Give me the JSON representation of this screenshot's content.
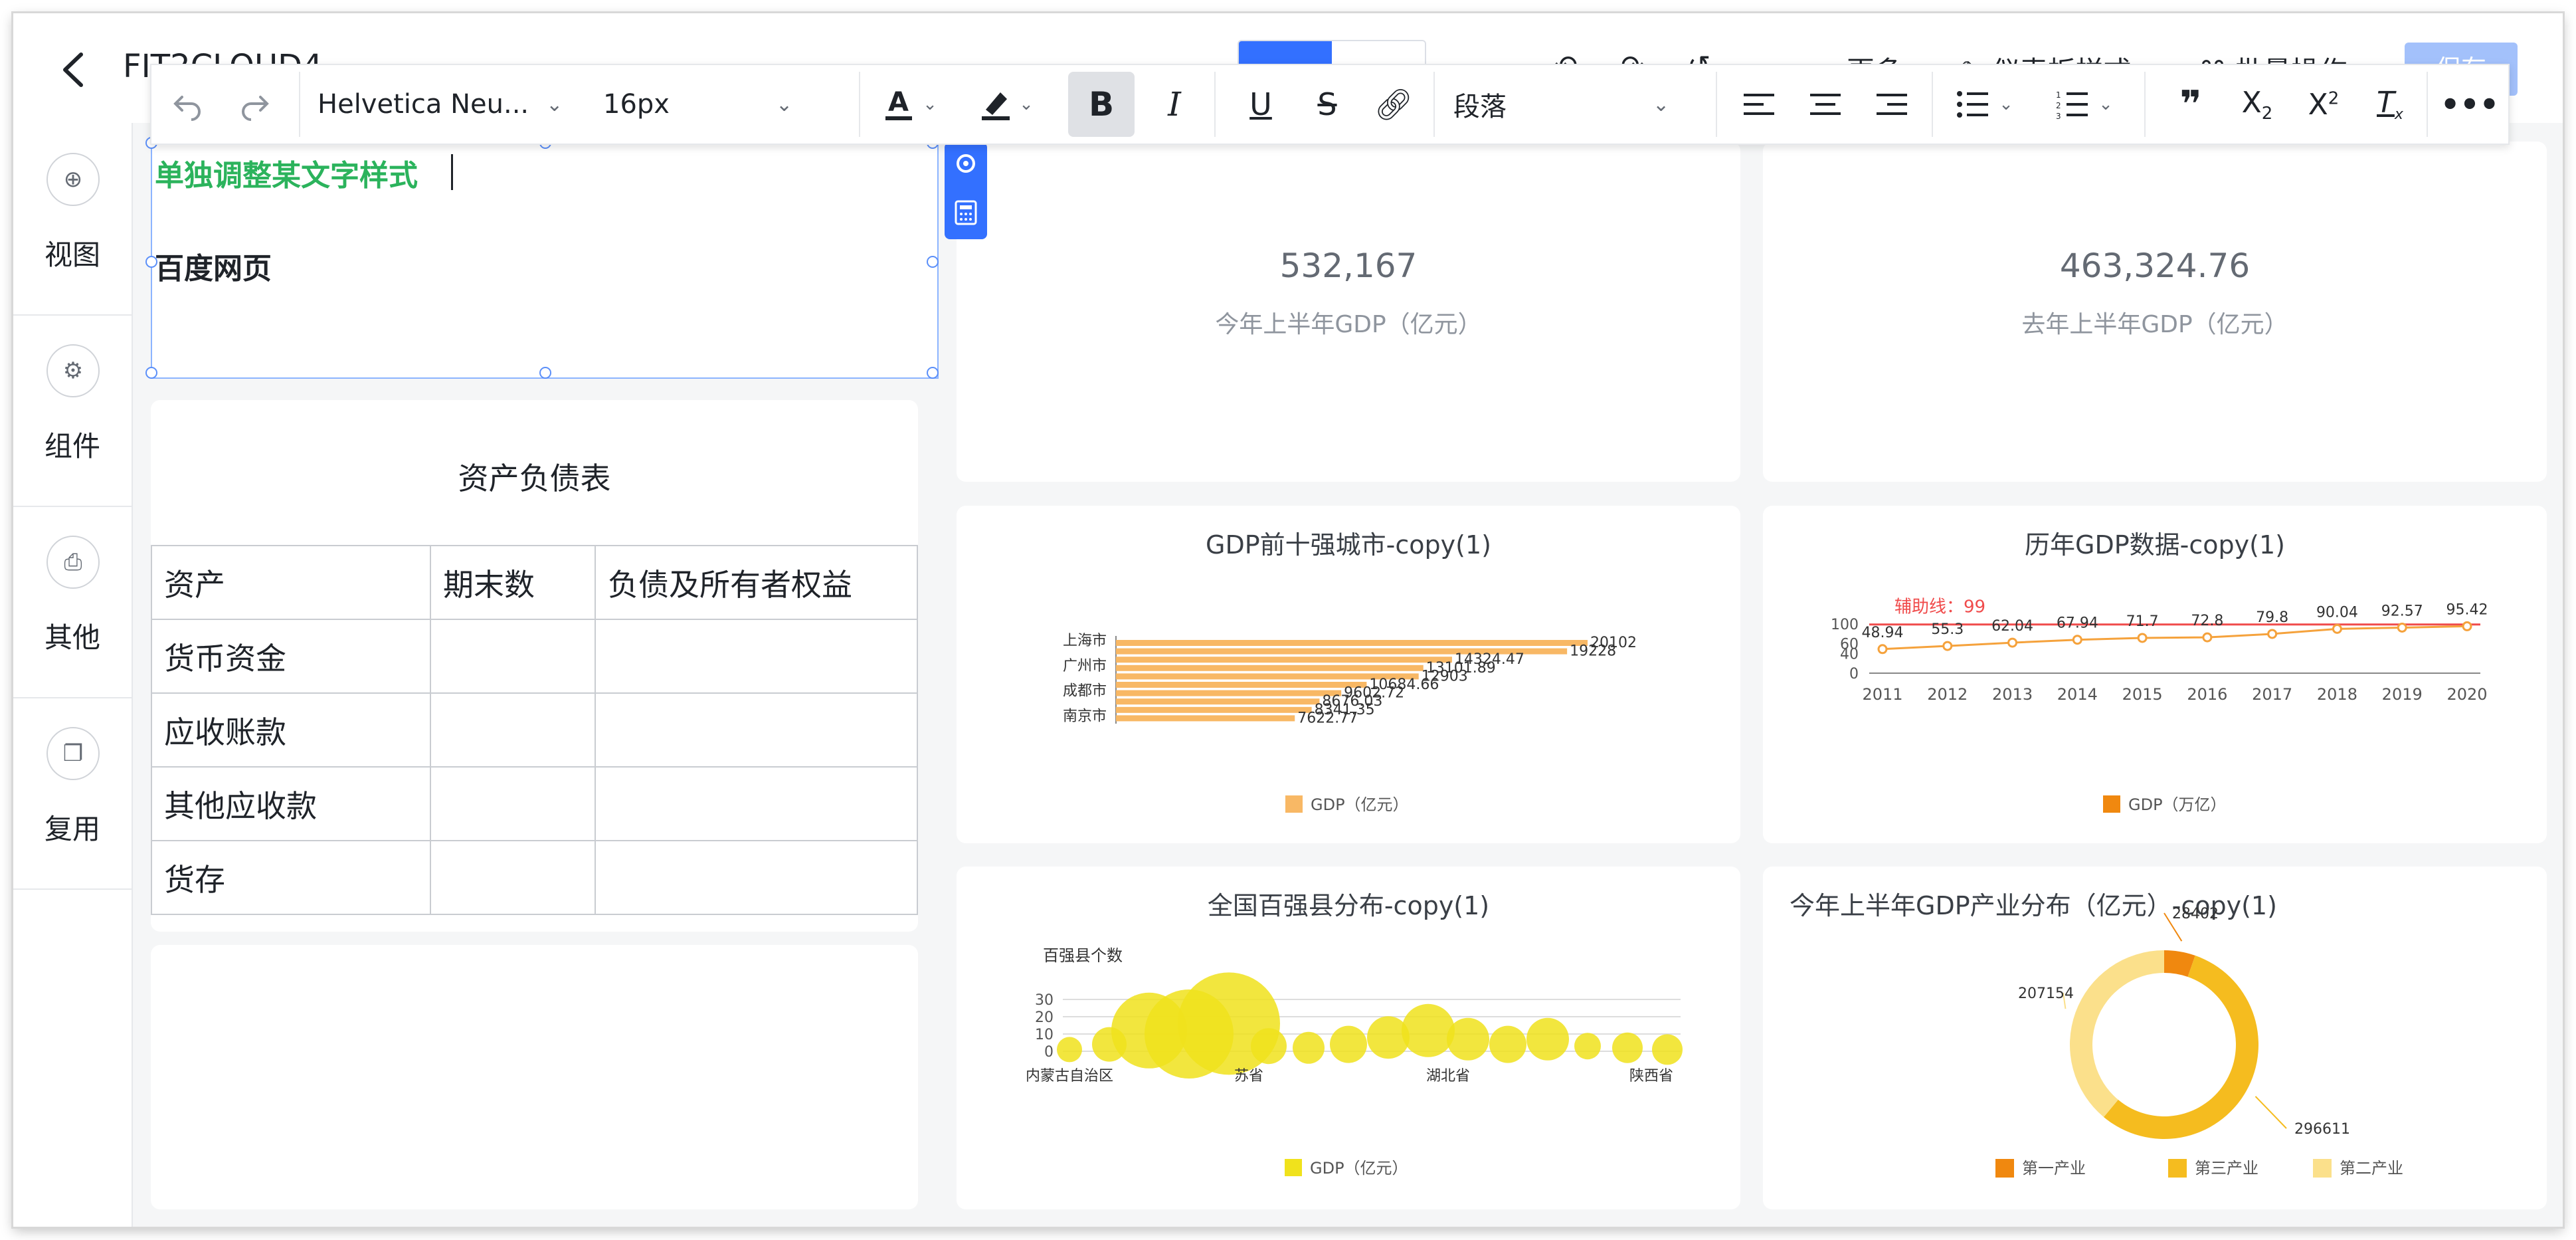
{
  "app": {
    "title": "FIT2CLOUD4"
  },
  "top_actions": {
    "more": "更多",
    "style": "仪表板样式",
    "batch": "批量操作",
    "save": "保存"
  },
  "sidebar": {
    "items": [
      {
        "label": "视图",
        "icon": "plus-circle-icon"
      },
      {
        "label": "组件",
        "icon": "gear-icon"
      },
      {
        "label": "其他",
        "icon": "printer-icon"
      },
      {
        "label": "复用",
        "icon": "copy-icon"
      }
    ]
  },
  "toolbar": {
    "font_family": "Helvetica Neu...",
    "font_size": "16px",
    "block_format": "段落"
  },
  "rich_text": {
    "line1": "单独调整某文字样式",
    "line2": "百度网页"
  },
  "balance_sheet": {
    "title": "资产负债表",
    "rows": [
      [
        "资产",
        "期末数",
        "负债及所有者权益"
      ],
      [
        "货币资金",
        "",
        ""
      ],
      [
        "应收账款",
        "",
        ""
      ],
      [
        "其他应收款",
        "",
        ""
      ],
      [
        "货存",
        "",
        ""
      ]
    ]
  },
  "kpis": [
    {
      "value": "532,167",
      "label": "今年上半年GDP（亿元）"
    },
    {
      "value": "463,324.76",
      "label": "去年上半年GDP（亿元）"
    }
  ],
  "colors": {
    "accent": "#3370ff",
    "bar": "#f8b865",
    "line": "#f5a23c",
    "aux_line": "#f04b4b",
    "bubble": "#f0e21c",
    "donut_primary": "#f0880f",
    "donut_tertiary": "#f5bc1f",
    "donut_secondary": "#fbe08b"
  },
  "chart_data": [
    {
      "type": "bar",
      "orientation": "horizontal",
      "title": "GDP前十强城市-copy(1)",
      "categories": [
        "上海市",
        "",
        "广州市",
        "",
        "成都市",
        "",
        "南京市"
      ],
      "values": [
        20102,
        19228,
        14324.47,
        13101.89,
        12903,
        10684.66,
        9602.72,
        8676.03,
        8341.35,
        7622.77
      ],
      "value_labels": [
        "20102",
        "19228",
        "14324.47",
        "13101.89",
        "12903",
        "10684.66",
        "9602.72",
        "8676.03",
        "8341.35",
        "7622.77"
      ],
      "legend": [
        "GDP（亿元）"
      ]
    },
    {
      "type": "line",
      "title": "历年GDP数据-copy(1)",
      "x": [
        "2011",
        "2012",
        "2013",
        "2014",
        "2015",
        "2016",
        "2017",
        "2018",
        "2019",
        "2020"
      ],
      "values": [
        48.94,
        55.3,
        62.04,
        67.94,
        71.7,
        72.8,
        79.8,
        90.04,
        92.57,
        95.42
      ],
      "value_labels": [
        "48.94",
        "55.3",
        "62.04",
        "67.94",
        "71.7",
        "72.8",
        "79.8",
        "90.04",
        "92.57",
        "95.42"
      ],
      "y_ticks": [
        "0",
        "40",
        "60",
        "100"
      ],
      "ylim": [
        0,
        100
      ],
      "aux_line": {
        "label": "辅助线：99",
        "value": 99
      },
      "legend": [
        "GDP（万亿）"
      ]
    },
    {
      "type": "scatter",
      "subtype": "bubble",
      "title": "全国百强县分布-copy(1)",
      "ylabel": "百强县个数",
      "y_ticks": [
        "0",
        "10",
        "20",
        "30"
      ],
      "x_labels": [
        "内蒙古自治区",
        "苏省",
        "湖北省",
        "陕西省"
      ],
      "points": [
        {
          "x": 0,
          "y": 1,
          "size": 14
        },
        {
          "x": 1,
          "y": 4,
          "size": 28
        },
        {
          "x": 2,
          "y": 12,
          "size": 90
        },
        {
          "x": 3,
          "y": 10,
          "size": 110
        },
        {
          "x": 4,
          "y": 16,
          "size": 130
        },
        {
          "x": 5,
          "y": 3,
          "size": 30
        },
        {
          "x": 6,
          "y": 2,
          "size": 24
        },
        {
          "x": 7,
          "y": 4,
          "size": 32
        },
        {
          "x": 8,
          "y": 8,
          "size": 40
        },
        {
          "x": 9,
          "y": 12,
          "size": 56
        },
        {
          "x": 10,
          "y": 7,
          "size": 40
        },
        {
          "x": 11,
          "y": 4,
          "size": 32
        },
        {
          "x": 12,
          "y": 7,
          "size": 40
        },
        {
          "x": 13,
          "y": 3,
          "size": 16
        },
        {
          "x": 14,
          "y": 2,
          "size": 22
        },
        {
          "x": 15,
          "y": 1,
          "size": 22
        }
      ],
      "legend": [
        "GDP（亿元）"
      ]
    },
    {
      "type": "pie",
      "subtype": "donut",
      "title": "今年上半年GDP产业分布（亿元）-copy(1)",
      "slices": [
        {
          "name": "第一产业",
          "value": 28402
        },
        {
          "name": "第三产业",
          "value": 296611
        },
        {
          "name": "第二产业",
          "value": 207154
        }
      ],
      "value_labels": [
        "28402",
        "296611",
        "207154"
      ],
      "legend": [
        "第一产业",
        "第三产业",
        "第二产业"
      ]
    }
  ]
}
